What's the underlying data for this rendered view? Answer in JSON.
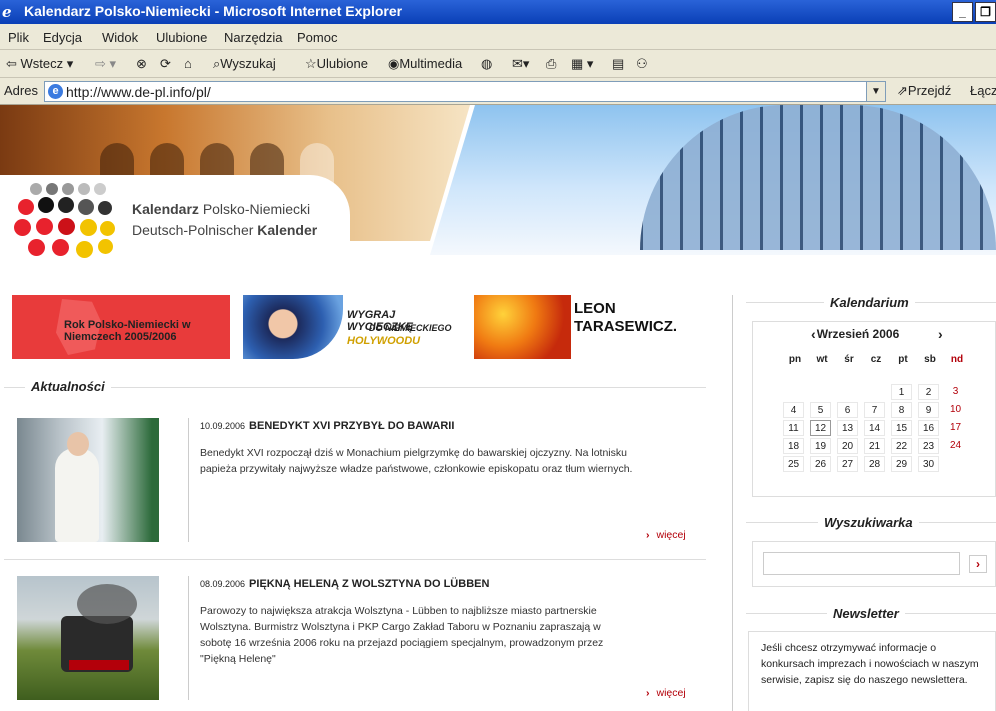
{
  "window": {
    "title": "Kalendarz Polsko-Niemiecki - Microsoft Internet Explorer"
  },
  "menu": [
    "Plik",
    "Edycja",
    "Widok",
    "Ulubione",
    "Narzędzia",
    "Pomoc"
  ],
  "toolbar": {
    "back": "Wstecz",
    "search": "Wyszukaj",
    "favorites": "Ulubione",
    "media": "Multimedia"
  },
  "address": {
    "label": "Adres",
    "url": "http://www.de-pl.info/pl/",
    "go": "Przejdź",
    "links": "Łącz"
  },
  "logo": {
    "line1a": "Kalendarz ",
    "line1b": "Polsko-Niemiecki",
    "line2a": "Deutsch-Polnischer ",
    "line2b": "Kalender"
  },
  "promos": [
    {
      "text": "Rok Polsko-Niemiecki w Niemczech 2005/2006"
    },
    {
      "line1": "WYGRAJ WYCIECZKĘ",
      "line2": "DO NIEMIECKIEGO",
      "line3": "HOLYWOODU"
    },
    {
      "line1": "LEON",
      "line2": "TARASEWICZ."
    }
  ],
  "news": {
    "heading": "Aktualności",
    "more": "więcej",
    "items": [
      {
        "date": "10.09.2006",
        "title": "BENEDYKT XVI PRZYBYŁ DO BAWARII",
        "text": "Benedykt XVI rozpoczął dziś w Monachium pielgrzymkę do bawarskiej ojczyzny. Na lotnisku papieża przywitały najwyższe władze państwowe, członkowie episkopatu oraz tłum wiernych."
      },
      {
        "date": "08.09.2006",
        "title": "PIĘKNĄ HELENĄ Z WOLSZTYNA DO LÜBBEN",
        "text": "Parowozy to największa atrakcja Wolsztyna - Lübben to najbliższe miasto partnerskie Wolsztyna. Burmistrz Wolsztyna i PKP Cargo Zakład Taboru w Poznaniu zapraszają w sobotę 16 września 2006 roku na przejazd pociągiem specjalnym, prowadzonym przez \"Piękną Helenę\""
      }
    ]
  },
  "calendar": {
    "heading": "Kalendarium",
    "month": "Wrzesień 2006",
    "days": [
      "pn",
      "wt",
      "śr",
      "cz",
      "pt",
      "sb",
      "nd"
    ],
    "weeks": [
      [
        "",
        "",
        "",
        "",
        "1",
        "2",
        "3"
      ],
      [
        "4",
        "5",
        "6",
        "7",
        "8",
        "9",
        "10"
      ],
      [
        "11",
        "12",
        "13",
        "14",
        "15",
        "16",
        "17"
      ],
      [
        "18",
        "19",
        "20",
        "21",
        "22",
        "23",
        "24"
      ],
      [
        "25",
        "26",
        "27",
        "28",
        "29",
        "30",
        ""
      ]
    ]
  },
  "search": {
    "heading": "Wyszukiwarka"
  },
  "newsletter": {
    "heading": "Newsletter",
    "text": "Jeśli chcesz otrzymywać informacje o konkursach imprezach i nowościach w naszym serwisie, zapisz się do naszego newslettera."
  }
}
